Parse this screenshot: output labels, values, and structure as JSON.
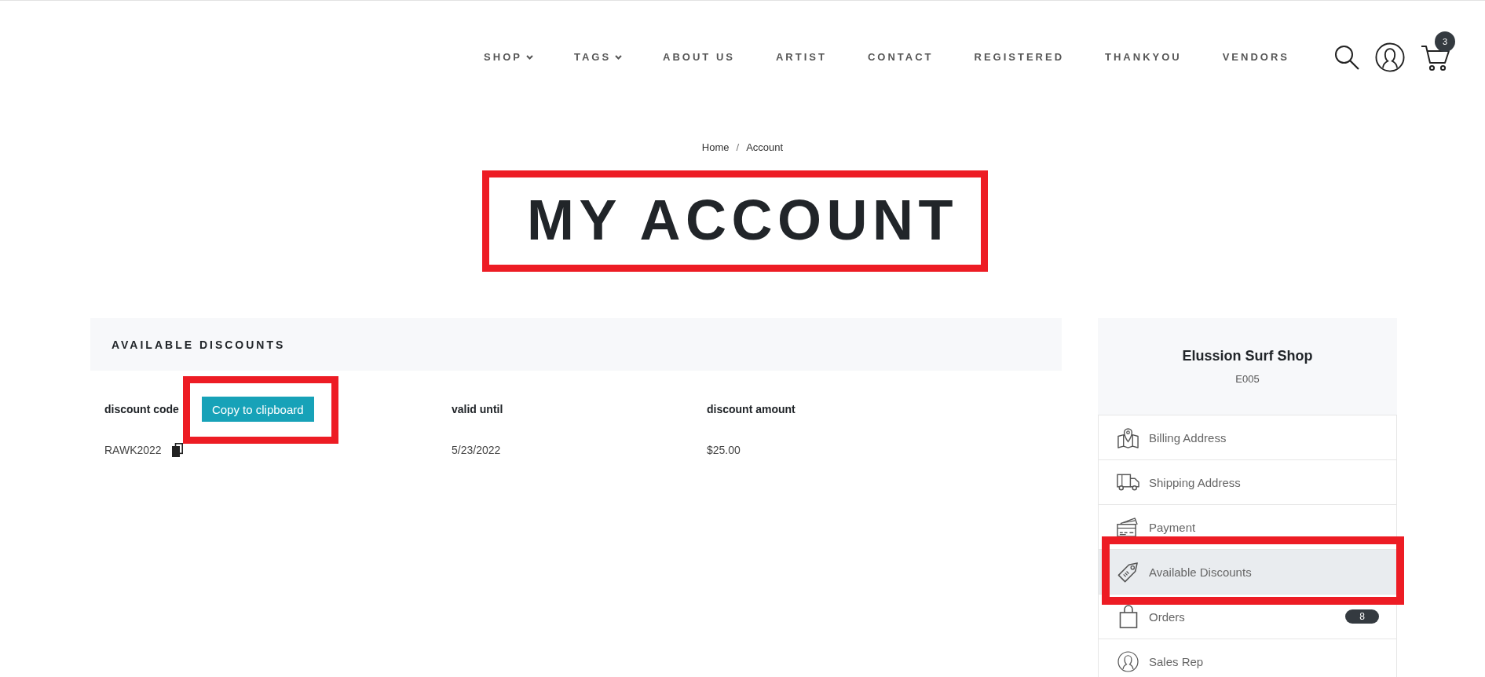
{
  "header": {
    "nav": [
      {
        "label": "SHOP",
        "dropdown": true
      },
      {
        "label": "TAGS",
        "dropdown": true
      },
      {
        "label": "ABOUT US",
        "dropdown": false
      },
      {
        "label": "ARTIST",
        "dropdown": false
      },
      {
        "label": "CONTACT",
        "dropdown": false
      },
      {
        "label": "REGISTERED",
        "dropdown": false
      },
      {
        "label": "THANKYOU",
        "dropdown": false
      },
      {
        "label": "VENDORS",
        "dropdown": false
      }
    ],
    "cart_count": "3"
  },
  "breadcrumb": {
    "items": [
      "Home",
      "Account"
    ],
    "separator": "/"
  },
  "title": {
    "text": "MY ACCOUNT",
    "highlighted": true
  },
  "discounts": {
    "heading": "AVAILABLE DISCOUNTS",
    "columns": [
      "discount code",
      "valid until",
      "discount amount"
    ],
    "copy_button": {
      "label": "Copy to clipboard",
      "highlighted": true
    },
    "rows": [
      {
        "cells": [
          "RAWK2022",
          "5/23/2022",
          "$25.00"
        ]
      }
    ]
  },
  "sidebar": {
    "account_name": "Elussion Surf Shop",
    "account_id": "E005",
    "items": [
      {
        "label": "Billing Address",
        "selected": false,
        "highlighted": false
      },
      {
        "label": "Shipping Address",
        "selected": false,
        "highlighted": false
      },
      {
        "label": "Payment",
        "selected": false,
        "highlighted": false
      },
      {
        "label": "Available Discounts",
        "selected": true,
        "highlighted": true
      },
      {
        "label": "Orders",
        "selected": false,
        "highlighted": false,
        "badge": "8"
      },
      {
        "label": "Sales Rep",
        "selected": false,
        "highlighted": false
      }
    ]
  }
}
